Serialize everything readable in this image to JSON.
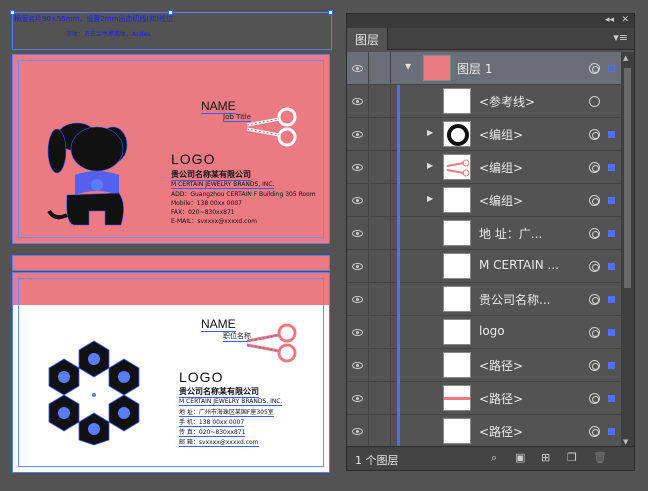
{
  "canvas": {
    "note_line1": "横版名片90×55mm，设置2mm出血切线(和)线位",
    "note_line2": "字体：方正兰亭黑简体、Andes",
    "front": {
      "name": "NAME",
      "title": "Job Title",
      "logo": "LOGO",
      "company": "贵公司名称某有限公司",
      "company_en": "M CERTAIN JEWELRY BRANDS, INC.",
      "lines": [
        "ADD：Guangzhou CERTAIN F Building 305 Room",
        "Mobile：138 00xx 0007",
        "FAX：020~830xx871",
        "E-MAIL：svxxxx@xxxxd.com"
      ]
    },
    "back": {
      "name": "NAME",
      "title": "职位名称",
      "logo": "LOGO",
      "company": "贵公司名称某有限公司",
      "company_en": "M CERTAIN JEWELRY BRANDS, INC.",
      "lines": [
        "地 址：广州市海珠区某国F座305室",
        "手 机：138 00xx 0007",
        "传 真：020~830xx871",
        "邮 箱：svxxxx@xxxxd.com"
      ]
    },
    "colors": {
      "card_pink": "#ec7a82",
      "selection_blue": "#3b5cff"
    }
  },
  "panel": {
    "tab_label": "图层",
    "collapse_icon": "double-chevron-left-icon",
    "close_icon": "close-icon",
    "menu_icon": "panel-menu-icon",
    "layers": [
      {
        "label": "图层 1",
        "type": "layer"
      },
      {
        "label": "<参考线>",
        "type": "guide"
      },
      {
        "label": "<编组>",
        "type": "group"
      },
      {
        "label": "<编组>",
        "type": "group"
      },
      {
        "label": "<编组>",
        "type": "group"
      },
      {
        "label": "地 址：广...",
        "type": "text"
      },
      {
        "label": "M CERTAIN ...",
        "type": "text"
      },
      {
        "label": "贵公司名称...",
        "type": "text"
      },
      {
        "label": "logo",
        "type": "text"
      },
      {
        "label": "<路径>",
        "type": "path"
      },
      {
        "label": "<路径>",
        "type": "path"
      },
      {
        "label": "<路径>",
        "type": "path"
      }
    ],
    "footer": {
      "count_label": "1 个图层"
    }
  }
}
